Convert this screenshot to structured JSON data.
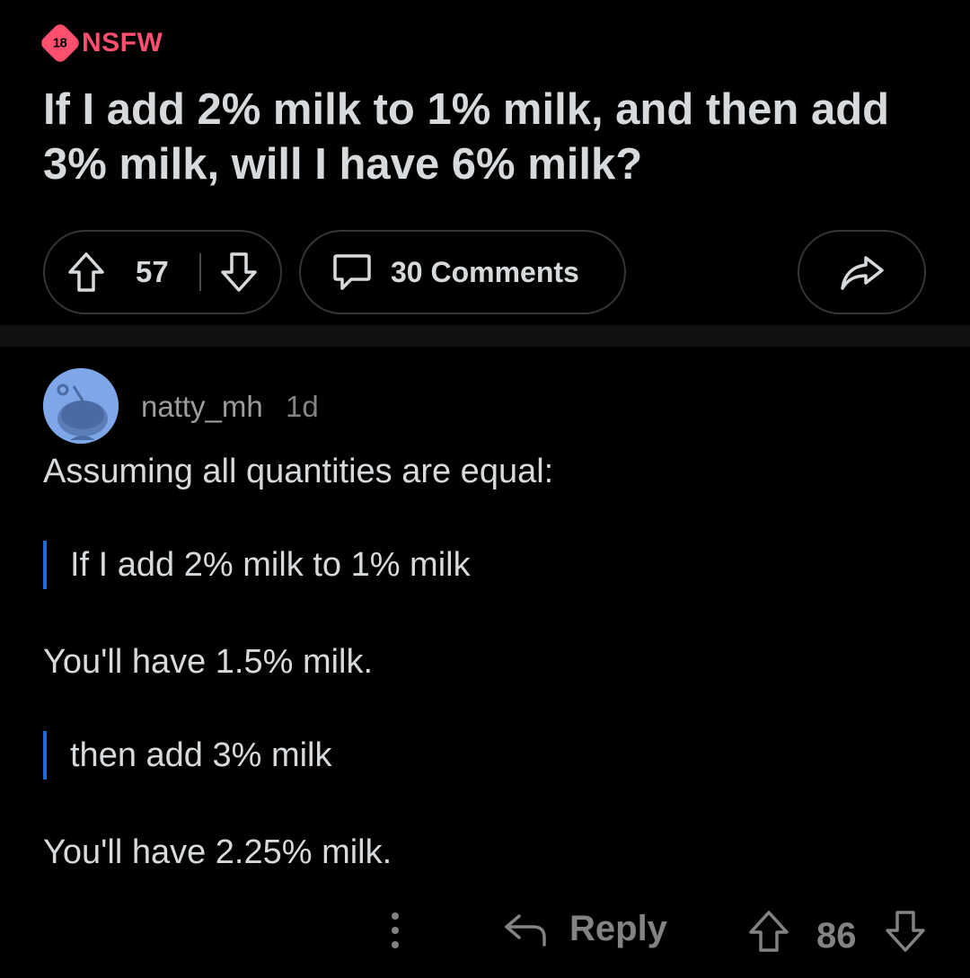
{
  "post": {
    "nsfw_badge": "18",
    "nsfw_label": "NSFW",
    "title": "If I add 2% milk to 1% milk, and then add 3% milk, will I have 6% milk?",
    "vote_count": "57",
    "comments_label": "30 Comments"
  },
  "comment": {
    "author": "natty_mh",
    "age": "1d",
    "intro": "Assuming all quantities are equal:",
    "quote_1": "If I add 2% milk to 1% milk",
    "answer_1": "You'll have 1.5% milk.",
    "quote_2": "then add 3% milk",
    "answer_2": "You'll have 2.25% milk.",
    "reply_label": "Reply",
    "vote_count": "86"
  },
  "colors": {
    "background": "#000000",
    "nsfw": "#ff4f6e",
    "text": "#d7dadc",
    "muted": "#818384",
    "quote_bar": "#1f6bd1",
    "avatar_bg": "#7da7e8"
  },
  "icons": [
    "upvote-icon",
    "downvote-icon",
    "comment-icon",
    "share-icon",
    "more-icon",
    "reply-icon"
  ]
}
